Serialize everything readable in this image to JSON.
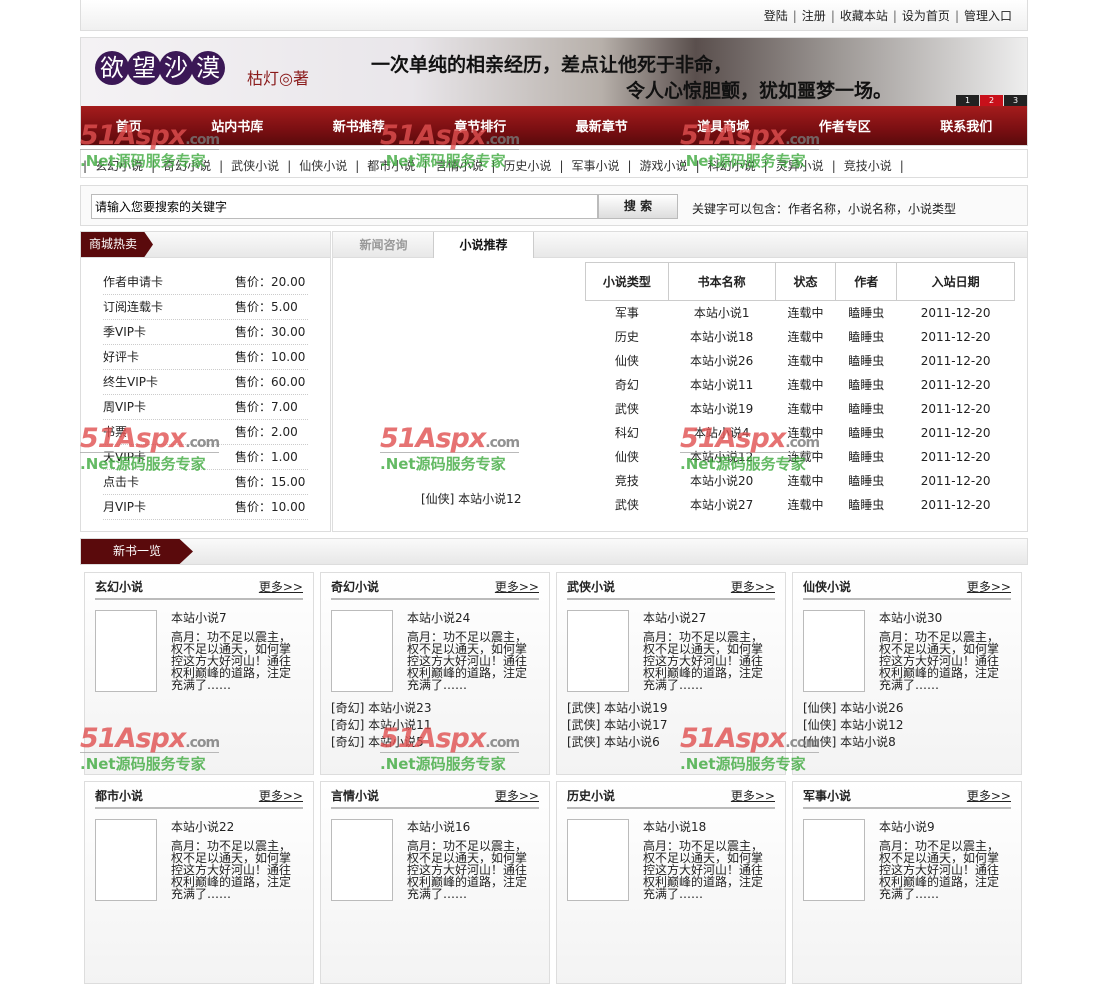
{
  "topbar": {
    "links": [
      "登陆",
      "注册",
      "收藏本站",
      "设为首页",
      "管理入口"
    ]
  },
  "banner": {
    "logo": [
      "欲",
      "望",
      "沙",
      "漠"
    ],
    "author": "枯灯◎著",
    "slogan1": "一次单纯的相亲经历，差点让他死于非命，",
    "slogan2": "令人心惊胆颤，犹如噩梦一场。",
    "pages": [
      "1",
      "2",
      "3"
    ],
    "active_page": 2
  },
  "nav": [
    "首页",
    "站内书库",
    "新书推荐",
    "章节排行",
    "最新章节",
    "道具商城",
    "作者专区",
    "联系我们"
  ],
  "categories": [
    "玄幻小说",
    "奇幻小说",
    "武侠小说",
    "仙侠小说",
    "都市小说",
    "言情小说",
    "历史小说",
    "军事小说",
    "游戏小说",
    "科幻小说",
    "灵异小说",
    "竞技小说"
  ],
  "search": {
    "placeholder": "请输入您要搜索的关键字",
    "button": "搜 索",
    "tip": "关键字可以包含：作者名称，小说名称，小说类型"
  },
  "shop": {
    "title": "商城热卖",
    "price_label": "售价：",
    "items": [
      [
        "作者申请卡",
        "20.00"
      ],
      [
        "订阅连载卡",
        "5.00"
      ],
      [
        "季VIP卡",
        "30.00"
      ],
      [
        "好评卡",
        "10.00"
      ],
      [
        "终生VIP卡",
        "60.00"
      ],
      [
        "周VIP卡",
        "7.00"
      ],
      [
        "书票",
        "2.00"
      ],
      [
        "天VIP卡",
        "1.00"
      ],
      [
        "点击卡",
        "15.00"
      ],
      [
        "月VIP卡",
        "10.00"
      ]
    ]
  },
  "recommend": {
    "tabs": [
      "新闻咨询",
      "小说推荐"
    ],
    "active_tab": 1,
    "side_link": "[仙侠] 本站小说12",
    "columns": [
      "小说类型",
      "书本名称",
      "状态",
      "作者",
      "入站日期"
    ],
    "rows": [
      [
        "军事",
        "本站小说1",
        "连载中",
        "瞌睡虫",
        "2011-12-20"
      ],
      [
        "历史",
        "本站小说18",
        "连载中",
        "瞌睡虫",
        "2011-12-20"
      ],
      [
        "仙侠",
        "本站小说26",
        "连载中",
        "瞌睡虫",
        "2011-12-20"
      ],
      [
        "奇幻",
        "本站小说11",
        "连载中",
        "瞌睡虫",
        "2011-12-20"
      ],
      [
        "武侠",
        "本站小说19",
        "连载中",
        "瞌睡虫",
        "2011-12-20"
      ],
      [
        "科幻",
        "本站小说4",
        "连载中",
        "瞌睡虫",
        "2011-12-20"
      ],
      [
        "仙侠",
        "本站小说12",
        "连载中",
        "瞌睡虫",
        "2011-12-20"
      ],
      [
        "竞技",
        "本站小说20",
        "连载中",
        "瞌睡虫",
        "2011-12-20"
      ],
      [
        "武侠",
        "本站小说27",
        "连载中",
        "瞌睡虫",
        "2011-12-20"
      ]
    ]
  },
  "newbooks": {
    "title": "新书一览",
    "more": "更多>>",
    "desc": "高月：功不足以震主，权不足以通天，如何掌控这方大好河山！通往权利巅峰的道路，注定充满了……",
    "cards": [
      {
        "title": "玄幻小说",
        "book": "本站小说7",
        "list": []
      },
      {
        "title": "奇幻小说",
        "book": "本站小说24",
        "list": [
          "[奇幻] 本站小说23",
          "[奇幻] 本站小说11",
          "[奇幻] 本站小说5"
        ]
      },
      {
        "title": "武侠小说",
        "book": "本站小说27",
        "list": [
          "[武侠] 本站小说19",
          "[武侠] 本站小说17",
          "[武侠] 本站小说6"
        ]
      },
      {
        "title": "仙侠小说",
        "book": "本站小说30",
        "list": [
          "[仙侠] 本站小说26",
          "[仙侠] 本站小说12",
          "[仙侠] 本站小说8"
        ]
      },
      {
        "title": "都市小说",
        "book": "本站小说22",
        "list": []
      },
      {
        "title": "言情小说",
        "book": "本站小说16",
        "list": []
      },
      {
        "title": "历史小说",
        "book": "本站小说18",
        "list": []
      },
      {
        "title": "军事小说",
        "book": "本站小说9",
        "list": []
      }
    ]
  },
  "watermark": {
    "brand": "51Aspx",
    "domain": ".com",
    "slogan": ".Net源码服务专家"
  }
}
